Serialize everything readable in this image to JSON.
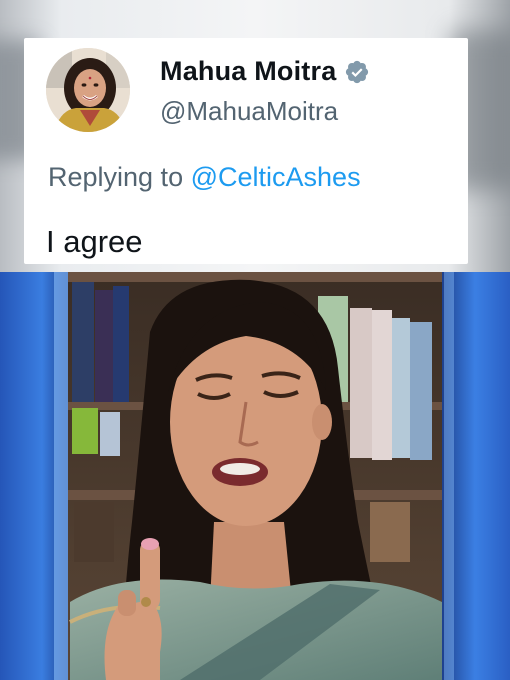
{
  "tweet": {
    "display_name": "Mahua Moitra",
    "handle": "@MahuaMoitra",
    "replying_prefix": "Replying to",
    "replying_handle": "@CelticAshes",
    "text": "I agree",
    "verified_icon": "verified-badge-icon"
  },
  "colors": {
    "name": "#0f1419",
    "secondary_text": "#536471",
    "mention": "#1d9bf0",
    "verified_badge": "#829aab",
    "card_background": "#ffffff",
    "studio_blue": "#2a63c9"
  }
}
